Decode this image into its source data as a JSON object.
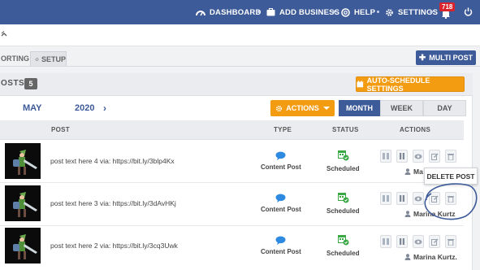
{
  "topnav": {
    "items": [
      {
        "label": "DASHBOARD",
        "icon": "dashboard-icon"
      },
      {
        "label": "ADD BUSINESS",
        "icon": "add-business-icon"
      },
      {
        "label": "HELP",
        "icon": "help-icon"
      },
      {
        "label": "SETTINGS",
        "icon": "gear-icon"
      }
    ],
    "notification_count": "718",
    "bg_color": "#3d5a99"
  },
  "tabs": [
    {
      "label": "ORTING"
    },
    {
      "label": "SETUP",
      "icon": "gear-icon"
    }
  ],
  "multi_post_label": "MULTI POST",
  "posts_header": {
    "title": "OSTS",
    "count": "5",
    "auto_schedule_label": "AUTO-SCHEDULE SETTINGS"
  },
  "calendar": {
    "month": "MAY",
    "year": "2020",
    "actions_label": "ACTIONS",
    "views": [
      "MONTH",
      "WEEK",
      "DAY"
    ],
    "active_view": "MONTH"
  },
  "table": {
    "columns": [
      "POST",
      "TYPE",
      "STATUS",
      "ACTIONS"
    ],
    "rows": [
      {
        "text": "post text here 4 via: https://bit.ly/3blp4Kx",
        "type": "Content Post",
        "status": "Scheduled",
        "owner": "Ma"
      },
      {
        "text": "post text here 3 via: https://bit.ly/3dAvHKj",
        "type": "Content Post",
        "status": "Scheduled",
        "owner": "Marina Kurtz"
      },
      {
        "text": "post text here 2 via: https://bit.ly/3cq3Uwk",
        "type": "Content Post",
        "status": "Scheduled",
        "owner": "Marina Kurtz."
      }
    ]
  },
  "tooltip": "DELETE POST",
  "colors": {
    "accent": "#3d5a99",
    "orange": "#f39c12",
    "type_icon": "#2d8ae0",
    "status_icon": "#3aa845",
    "annotation": "#3d5a99"
  }
}
